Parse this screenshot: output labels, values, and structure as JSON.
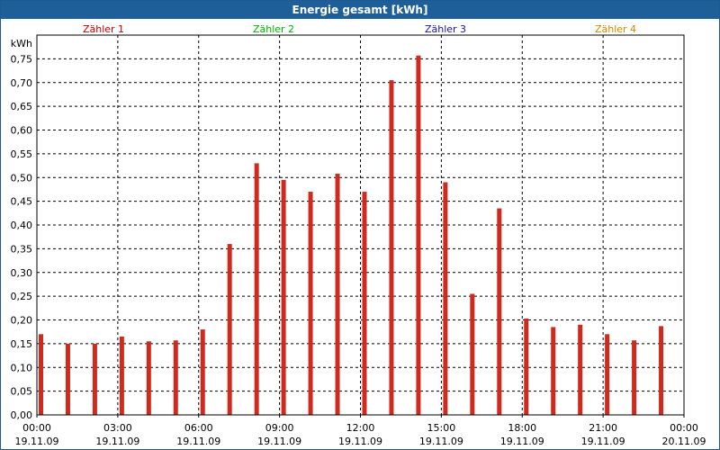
{
  "window": {
    "title": "Energie gesamt [kWh]"
  },
  "colors": {
    "titlebar": "#1f5f99",
    "series_red": "#d02a1e",
    "legend_1": "#c00000",
    "legend_2": "#00b000",
    "legend_3": "#1a12a8",
    "legend_4": "#d08a00"
  },
  "chart_data": {
    "type": "bar",
    "title": "Energie gesamt [kWh]",
    "ylabel": "kWh",
    "ylim": [
      0,
      0.8
    ],
    "grid": true,
    "legend_placement": "top",
    "legend": [
      {
        "name": "Zähler 1",
        "color": "#c00000"
      },
      {
        "name": "Zähler 2",
        "color": "#00b000"
      },
      {
        "name": "Zähler 3",
        "color": "#1a12a8"
      },
      {
        "name": "Zähler 4",
        "color": "#d08a00"
      }
    ],
    "y_ticks": [
      "0,00",
      "0,05",
      "0,10",
      "0,15",
      "0,20",
      "0,25",
      "0,30",
      "0,35",
      "0,40",
      "0,45",
      "0,50",
      "0,55",
      "0,60",
      "0,65",
      "0,70",
      "0,75"
    ],
    "x_ticks": [
      {
        "time": "00:00",
        "date": "19.11.09"
      },
      {
        "time": "03:00",
        "date": "19.11.09"
      },
      {
        "time": "06:00",
        "date": "19.11.09"
      },
      {
        "time": "09:00",
        "date": "19.11.09"
      },
      {
        "time": "12:00",
        "date": "19.11.09"
      },
      {
        "time": "15:00",
        "date": "19.11.09"
      },
      {
        "time": "18:00",
        "date": "19.11.09"
      },
      {
        "time": "21:00",
        "date": "19.11.09"
      },
      {
        "time": "00:00",
        "date": "20.11.09"
      }
    ],
    "x": [
      "00:00",
      "01:00",
      "02:00",
      "03:00",
      "04:00",
      "05:00",
      "06:00",
      "07:00",
      "08:00",
      "09:00",
      "10:00",
      "11:00",
      "12:00",
      "13:00",
      "14:00",
      "15:00",
      "16:00",
      "17:00",
      "18:00",
      "19:00",
      "20:00",
      "21:00",
      "22:00",
      "23:00"
    ],
    "series": [
      {
        "name": "Zähler 1",
        "color": "#d02a1e",
        "values": [
          0.17,
          0.15,
          0.15,
          0.165,
          0.155,
          0.157,
          0.18,
          0.36,
          0.53,
          0.495,
          0.47,
          0.508,
          0.47,
          0.705,
          0.757,
          0.49,
          0.255,
          0.435,
          0.203,
          0.185,
          0.19,
          0.17,
          0.157,
          0.187
        ]
      }
    ]
  }
}
